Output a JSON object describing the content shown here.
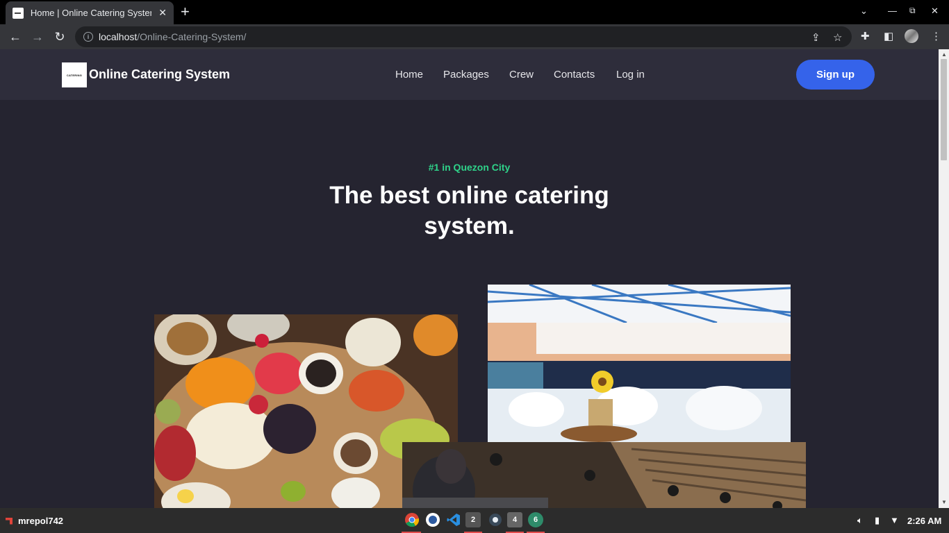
{
  "browser": {
    "tab": {
      "title": "Home | Online Catering System"
    },
    "url": {
      "host": "localhost",
      "path": "/Online-Catering-System/"
    }
  },
  "site": {
    "brand": "Online Catering System",
    "logo_text": "CATERING",
    "nav": [
      {
        "label": "Home"
      },
      {
        "label": "Packages"
      },
      {
        "label": "Crew"
      },
      {
        "label": "Contacts"
      },
      {
        "label": "Log in"
      }
    ],
    "signup_label": "Sign up",
    "hero": {
      "eyebrow": "#1 in Quezon City",
      "headline": "The best online catering system."
    },
    "colors": {
      "accent": "#3563ea",
      "eyebrow": "#2fd38a",
      "background": "#252430",
      "header": "#2e2d3b"
    }
  },
  "taskbar": {
    "user": "mrepol742",
    "apps": [
      {
        "icon": "chrome-icon"
      },
      {
        "icon": "app-icon"
      },
      {
        "icon": "vscode-icon"
      },
      {
        "icon": "terminal-icon",
        "badge": "2"
      },
      {
        "icon": "settings-icon"
      },
      {
        "icon": "files-icon",
        "badge": "4"
      },
      {
        "icon": "app-icon",
        "badge": "6"
      }
    ],
    "clock": "2:26 AM"
  }
}
